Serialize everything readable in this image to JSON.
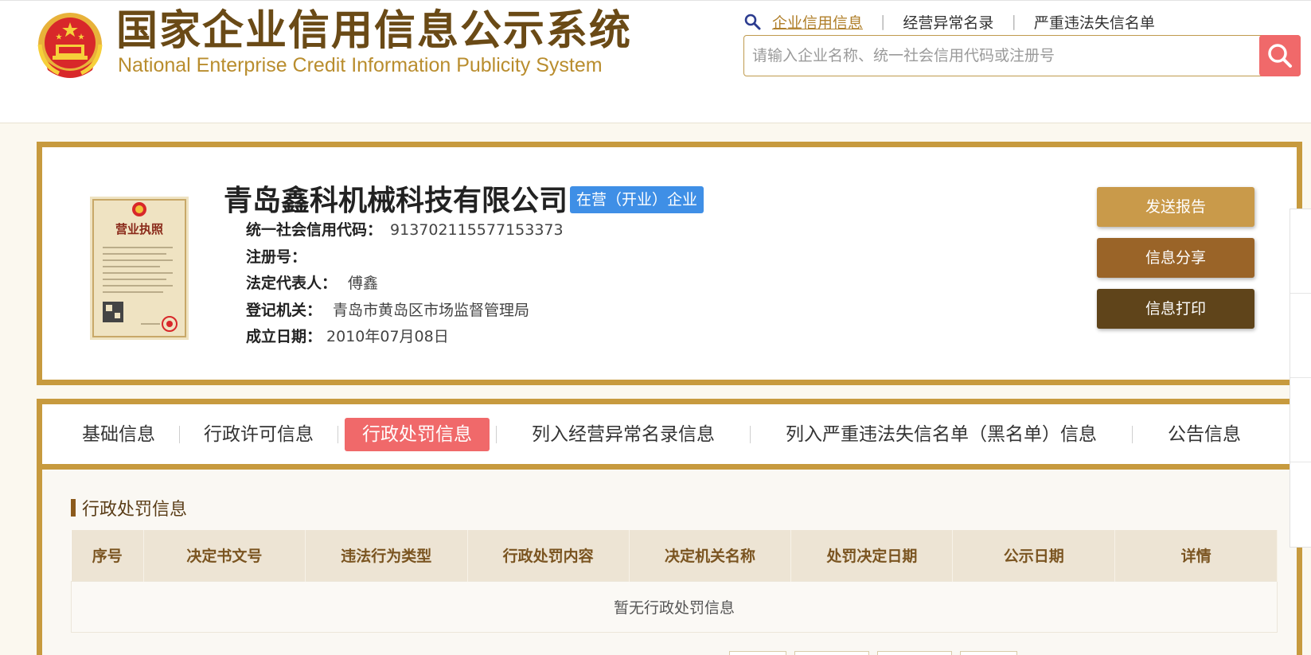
{
  "header": {
    "logo_cn": "国家企业信用信息公示系统",
    "logo_en": "National Enterprise Credit Information Publicity System",
    "nav": [
      {
        "label": "企业信用信息",
        "active": true
      },
      {
        "label": "经营异常名录",
        "active": false
      },
      {
        "label": "严重违法失信名单",
        "active": false
      }
    ],
    "search_placeholder": "请输入企业名称、统一社会信用代码或注册号",
    "icons": {
      "nav": "magnifier-icon",
      "search": "search-icon",
      "emblem": "national-emblem-icon"
    }
  },
  "company": {
    "name": "青岛鑫科机械科技有限公司",
    "status": "在营（开业）企业",
    "fields": [
      {
        "label": "统一社会信用代码：",
        "value": "913702115577153373"
      },
      {
        "label": "注册号：",
        "value": ""
      },
      {
        "label": "法定代表人：",
        "value": "傅鑫"
      },
      {
        "label": "登记机关：",
        "value": "青岛市黄岛区市场监督管理局"
      },
      {
        "label": "成立日期：",
        "value": "2010年07月08日"
      }
    ],
    "license_title": "营业执照",
    "actions": [
      {
        "label": "发送报告",
        "color": "#c99a4a"
      },
      {
        "label": "信息分享",
        "color": "#9a6428"
      },
      {
        "label": "信息打印",
        "color": "#5f441a"
      }
    ]
  },
  "tabs": [
    {
      "label": "基础信息",
      "active": false
    },
    {
      "label": "行政许可信息",
      "active": false
    },
    {
      "label": "行政处罚信息",
      "active": true
    },
    {
      "label": "列入经营异常名录信息",
      "active": false
    },
    {
      "label": "列入严重违法失信名单（黑名单）信息",
      "active": false
    },
    {
      "label": "公告信息",
      "active": false
    }
  ],
  "penalty": {
    "title": "行政处罚信息",
    "columns": [
      "序号",
      "决定书文号",
      "违法行为类型",
      "行政处罚内容",
      "决定机关名称",
      "处罚决定日期",
      "公示日期",
      "详情"
    ],
    "empty_text": "暂无行政处罚信息"
  },
  "colors": {
    "accent": "#c79a3e",
    "active_tab": "#f0696a",
    "badge": "#3f8fe6"
  }
}
